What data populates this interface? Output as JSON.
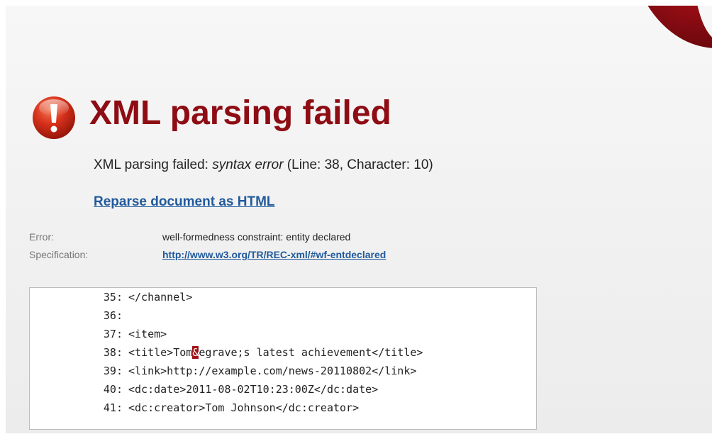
{
  "title": "XML parsing failed",
  "message": {
    "prefix": "XML parsing failed: ",
    "error_type": "syntax error",
    "suffix": " (Line: 38, Character: 10)"
  },
  "reparse_link": "Reparse document as HTML",
  "details": {
    "error_label": "Error:",
    "error_value": "well-formedness constraint: entity declared",
    "spec_label": "Specification:",
    "spec_link": "http://www.w3.org/TR/REC-xml/#wf-entdeclared"
  },
  "source": {
    "lines": [
      {
        "number": "35:",
        "before": "</channel>",
        "highlight": "",
        "after": ""
      },
      {
        "number": "36:",
        "before": "",
        "highlight": "",
        "after": ""
      },
      {
        "number": "37:",
        "before": "<item>",
        "highlight": "",
        "after": ""
      },
      {
        "number": "38:",
        "before": "<title>Tom",
        "highlight": "&",
        "after": "egrave;s latest achievement</title>"
      },
      {
        "number": "39:",
        "before": "<link>http://example.com/news-20110802</link>",
        "highlight": "",
        "after": ""
      },
      {
        "number": "40:",
        "before": "<dc:date>2011-08-02T10:23:00Z</dc:date>",
        "highlight": "",
        "after": ""
      },
      {
        "number": "41:",
        "before": "<dc:creator>Tom Johnson</dc:creator>",
        "highlight": "",
        "after": ""
      }
    ]
  },
  "colors": {
    "title": "#8e0c14",
    "link": "#215a9c",
    "error_highlight": "#a11119"
  },
  "icons": {
    "error": "exclamation-circle-icon",
    "logo": "opera-logo"
  }
}
